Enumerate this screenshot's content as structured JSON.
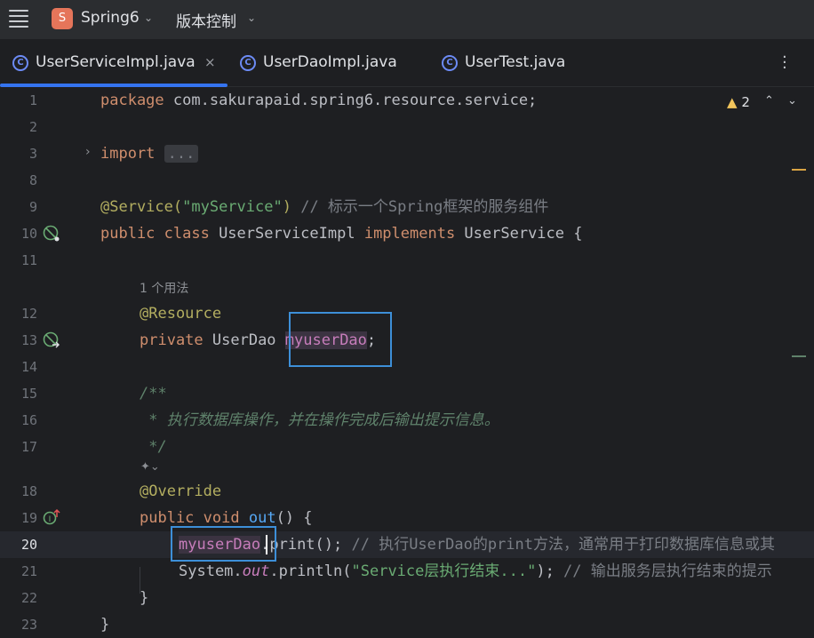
{
  "titlebar": {
    "project_badge": "S",
    "project_name": "Spring6",
    "vcs_label": "版本控制"
  },
  "tabs": [
    {
      "label": "UserServiceImpl.java",
      "active": true,
      "close": "×",
      "icon": "class-icon"
    },
    {
      "label": "UserDaoImpl.java",
      "active": false,
      "icon": "class-icon"
    },
    {
      "label": "UserTest.java",
      "active": false,
      "icon": "class-icon"
    }
  ],
  "editor": {
    "inspection": {
      "count": "2",
      "icon": "warning-triangle-icon"
    },
    "line_numbers": [
      "1",
      "2",
      "3",
      "8",
      "9",
      "10",
      "11",
      "12",
      "13",
      "14",
      "15",
      "16",
      "17",
      "18",
      "19",
      "20",
      "21",
      "22",
      "23"
    ],
    "current_line": "20",
    "lines": {
      "l1": {
        "kw": "package",
        "rest": " com.sakurapaid.spring6.resource.service;"
      },
      "l3": {
        "kw": "import",
        "fold": "..."
      },
      "l9": {
        "ann": "@Service(",
        "str": "\"myService\"",
        "close": ") ",
        "cmt": "// 标示一个Spring框架的服务组件"
      },
      "l10": {
        "kw1": "public class",
        "name": " UserServiceImpl ",
        "kw2": "implements",
        "rest": " UserService {"
      },
      "usage_hint": "1 个用法",
      "l12": {
        "ann": "@Resource"
      },
      "l13": {
        "kw": "private",
        "type": " UserDao ",
        "field": "myuserDao",
        "end": ";"
      },
      "l15": {
        "doc": "/**"
      },
      "l16": {
        "doc": " * 执行数据库操作，并在操作完成后输出提示信息。"
      },
      "l17": {
        "doc": " */"
      },
      "l18": {
        "ann": "@Override"
      },
      "l19": {
        "kw": "public void",
        "sp": " ",
        "method": "out",
        "rest": "() {"
      },
      "l20": {
        "field": "myuserDao",
        "call": ".print(); ",
        "cmt": "// 执行UserDao的print方法，通常用于打印数据库信息或其"
      },
      "l21": {
        "sys": "System.",
        "out": "out",
        "call": ".println(",
        "str": "\"Service层执行结束...\"",
        "end": "); ",
        "cmt": "// 输出服务层执行结束的提示"
      },
      "l22": {
        "brace": "}"
      },
      "l23": {
        "brace": "}"
      }
    }
  },
  "colors": {
    "background": "#1e1f22",
    "keyword": "#cf8e6d",
    "annotation": "#b3ae60",
    "string": "#6aab73",
    "comment": "#7a7e85",
    "field": "#c77dbb",
    "method": "#56a8f5",
    "highlight_box": "#3d8fd8",
    "tab_accent": "#3574f0"
  }
}
